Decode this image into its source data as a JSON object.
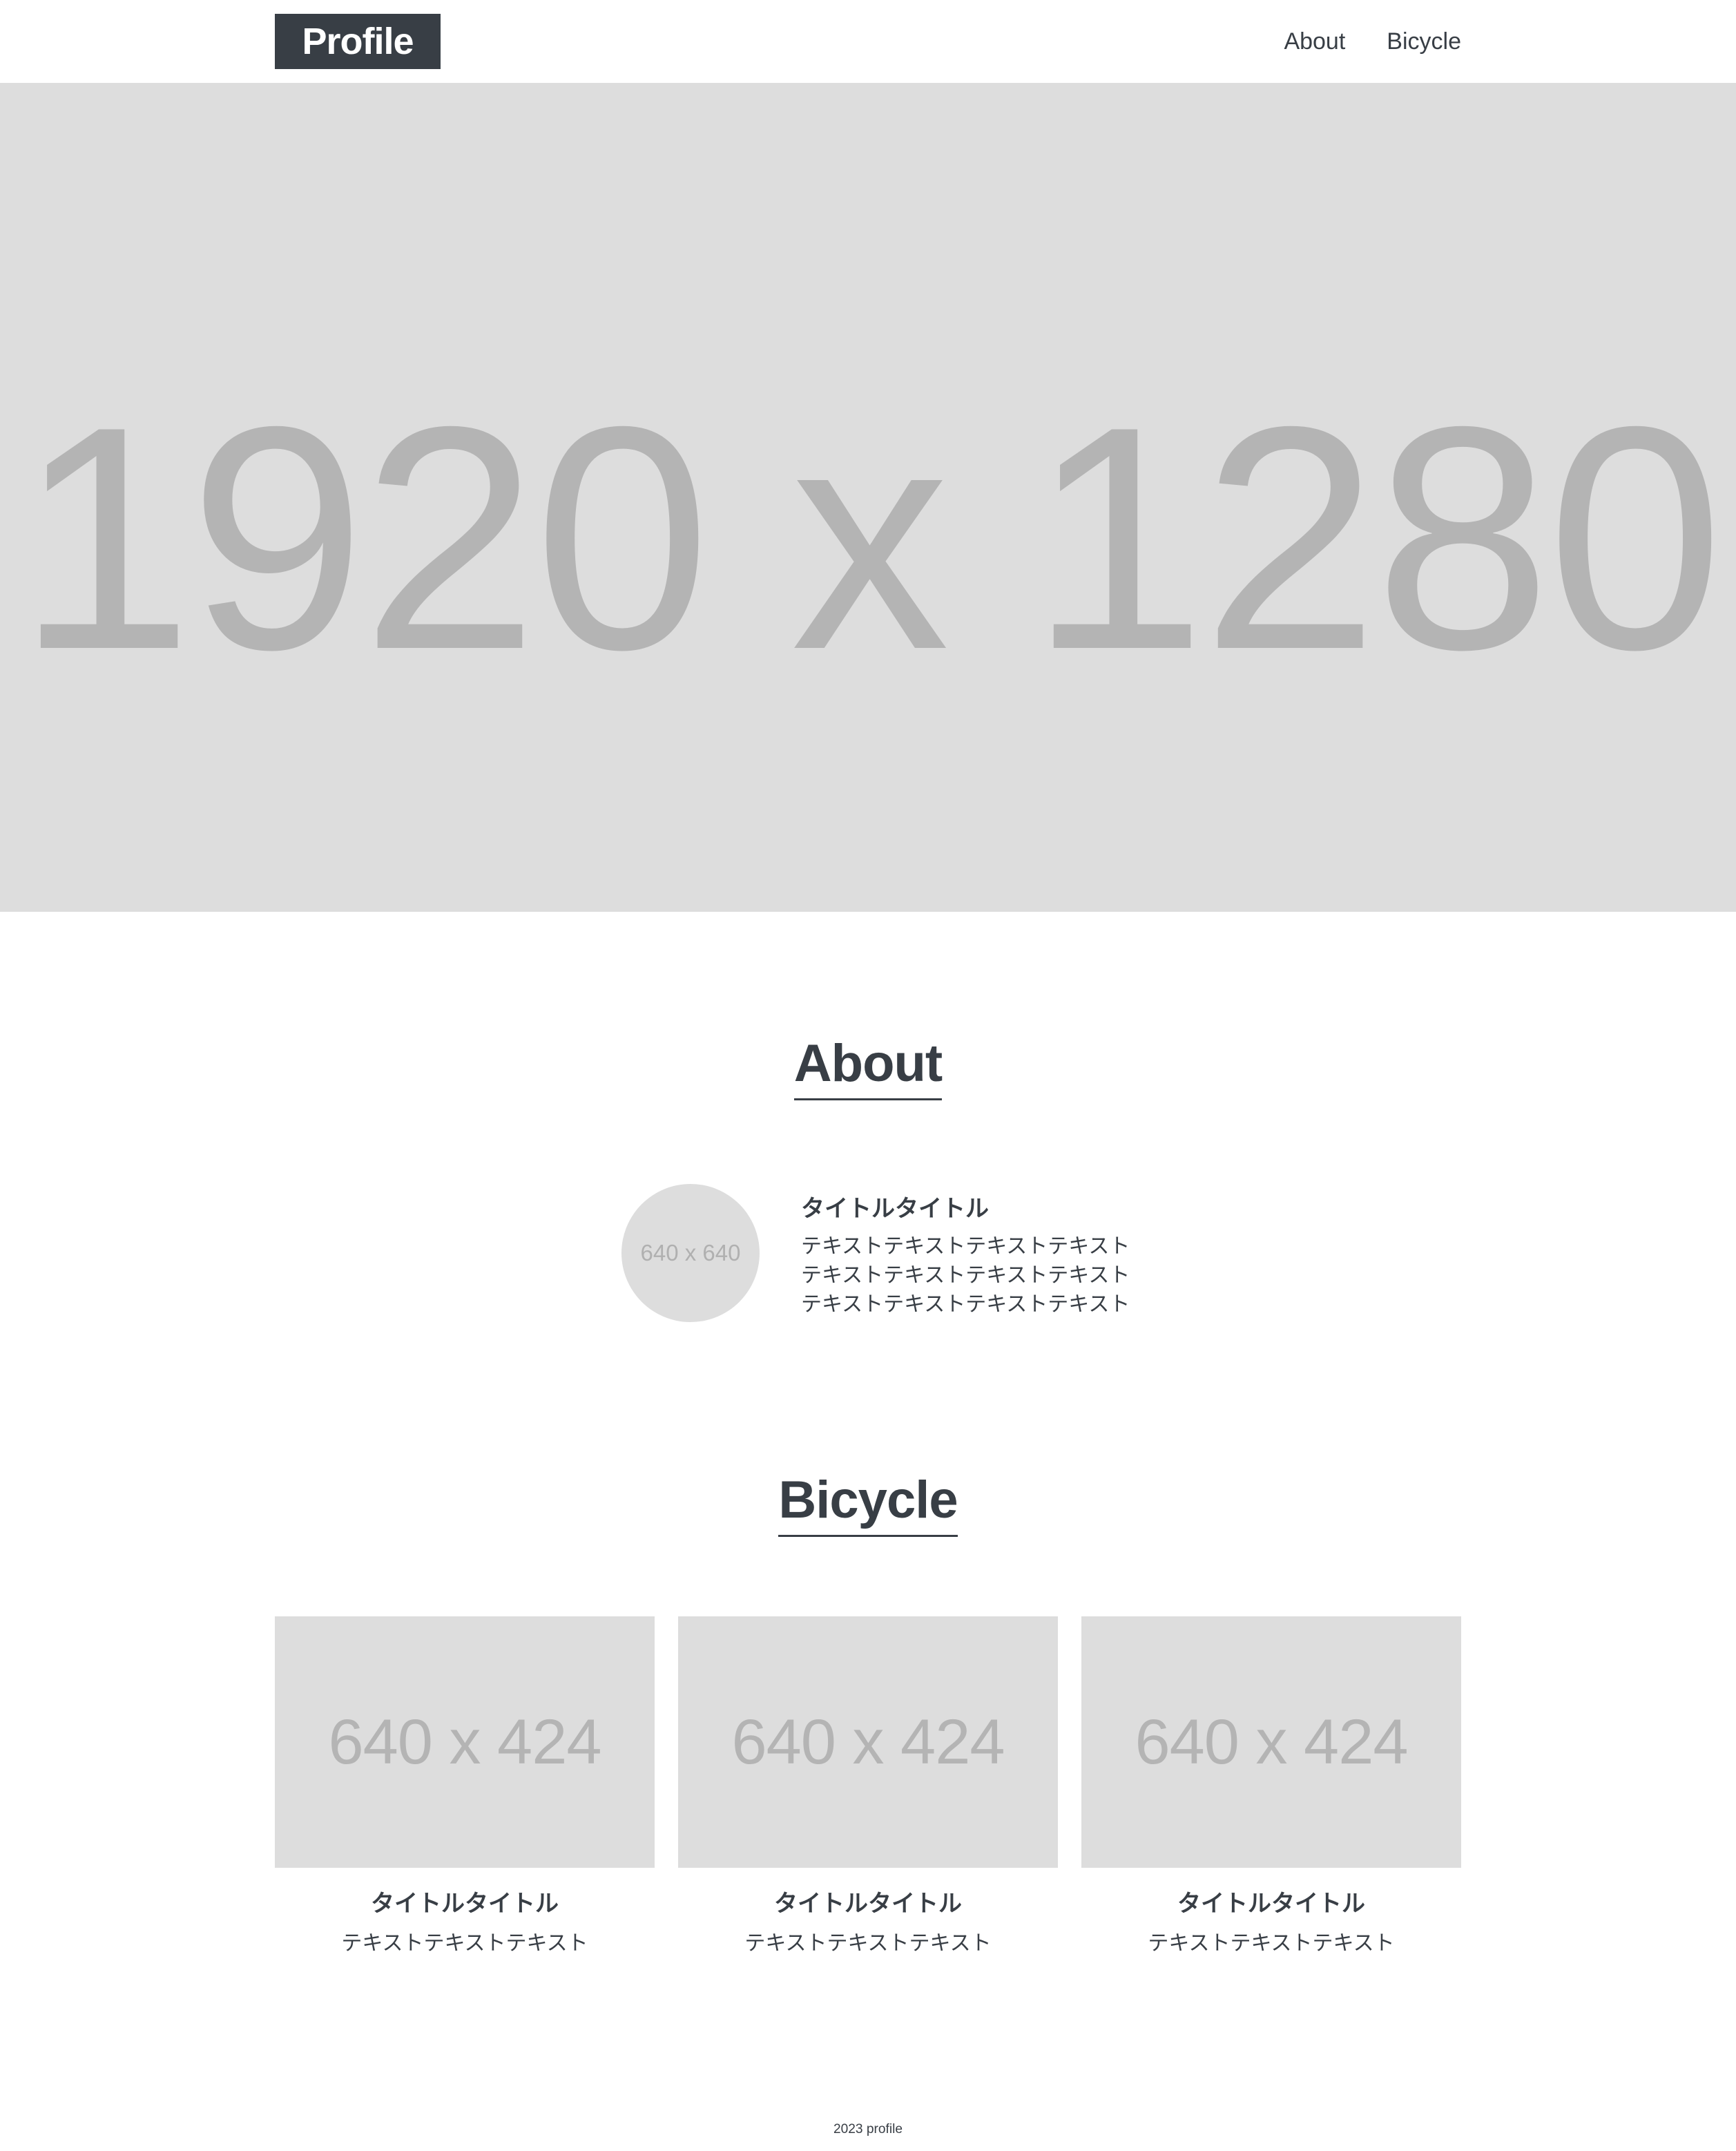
{
  "header": {
    "logo": "Profile",
    "nav": [
      {
        "label": "About"
      },
      {
        "label": "Bicycle"
      }
    ]
  },
  "hero": {
    "placeholder": "1920 x 1280"
  },
  "about": {
    "heading": "About",
    "avatar_placeholder": "640 x 640",
    "title": "タイトルタイトル",
    "body_lines": [
      "テキストテキストテキストテキスト",
      "テキストテキストテキストテキスト",
      "テキストテキストテキストテキスト"
    ]
  },
  "bicycle": {
    "heading": "Bicycle",
    "cards": [
      {
        "image_placeholder": "640 x 424",
        "title": "タイトルタイトル",
        "text": "テキストテキストテキスト"
      },
      {
        "image_placeholder": "640 x 424",
        "title": "タイトルタイトル",
        "text": "テキストテキストテキスト"
      },
      {
        "image_placeholder": "640 x 424",
        "title": "タイトルタイトル",
        "text": "テキストテキストテキスト"
      }
    ]
  },
  "footer": {
    "copyright": "2023 profile"
  },
  "colors": {
    "primary_text": "#383e45",
    "placeholder_bg": "#dddddd",
    "placeholder_text": "#b4b4b4",
    "background": "#ffffff"
  }
}
